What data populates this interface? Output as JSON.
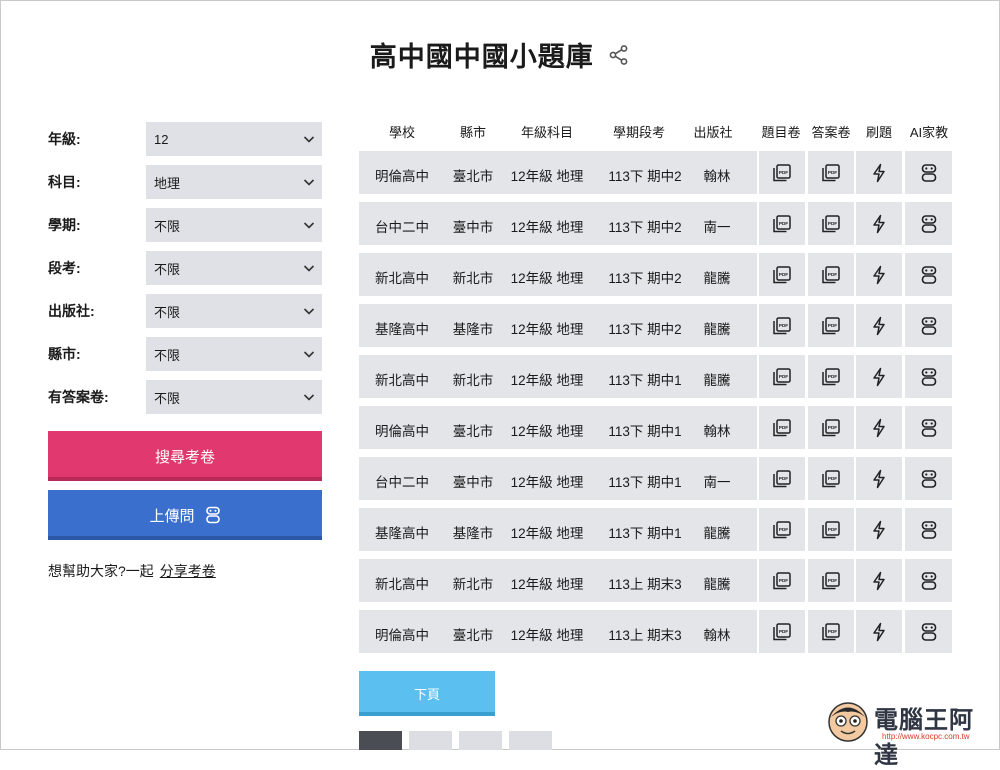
{
  "page": {
    "title": "高中國中國小題庫"
  },
  "filters": [
    {
      "label": "年級:",
      "value": "12"
    },
    {
      "label": "科目:",
      "value": "地理"
    },
    {
      "label": "學期:",
      "value": "不限"
    },
    {
      "label": "段考:",
      "value": "不限"
    },
    {
      "label": "出版社:",
      "value": "不限"
    },
    {
      "label": "縣市:",
      "value": "不限"
    },
    {
      "label": "有答案卷:",
      "value": "不限"
    }
  ],
  "actions": {
    "search_label": "搜尋考卷",
    "upload_label": "上傳問",
    "help_text": "想幫助大家?一起",
    "share_link": "分享考卷",
    "next_label": "下頁"
  },
  "table": {
    "headers": [
      "學校",
      "縣市",
      "年級科目",
      "學期段考",
      "出版社",
      "題目卷",
      "答案卷",
      "刷題",
      "AI家教"
    ],
    "rows": [
      [
        "明倫高中",
        "臺北市",
        "12年級 地理",
        "113下 期中2",
        "翰林"
      ],
      [
        "台中二中",
        "臺中市",
        "12年級 地理",
        "113下 期中2",
        "南一"
      ],
      [
        "新北高中",
        "新北市",
        "12年級 地理",
        "113下 期中2",
        "龍騰"
      ],
      [
        "基隆高中",
        "基隆市",
        "12年級 地理",
        "113下 期中2",
        "龍騰"
      ],
      [
        "新北高中",
        "新北市",
        "12年級 地理",
        "113下 期中1",
        "龍騰"
      ],
      [
        "明倫高中",
        "臺北市",
        "12年級 地理",
        "113下 期中1",
        "翰林"
      ],
      [
        "台中二中",
        "臺中市",
        "12年級 地理",
        "113下 期中1",
        "南一"
      ],
      [
        "基隆高中",
        "基隆市",
        "12年級 地理",
        "113下 期中1",
        "龍騰"
      ],
      [
        "新北高中",
        "新北市",
        "12年級 地理",
        "113上 期末3",
        "龍騰"
      ],
      [
        "明倫高中",
        "臺北市",
        "12年級 地理",
        "113上 期末3",
        "翰林"
      ]
    ],
    "action_icons": [
      "pdf-stack-icon",
      "pdf-stack-icon",
      "lightning-icon",
      "robot-icon"
    ]
  },
  "watermark": {
    "text": "電腦王阿達",
    "url": "http://www.kocpc.com.tw"
  },
  "colors": {
    "search_button": "#e0386f",
    "upload_button": "#3b6fce",
    "next_button": "#5bc0ef",
    "cell_bg": "#e3e5e9"
  }
}
